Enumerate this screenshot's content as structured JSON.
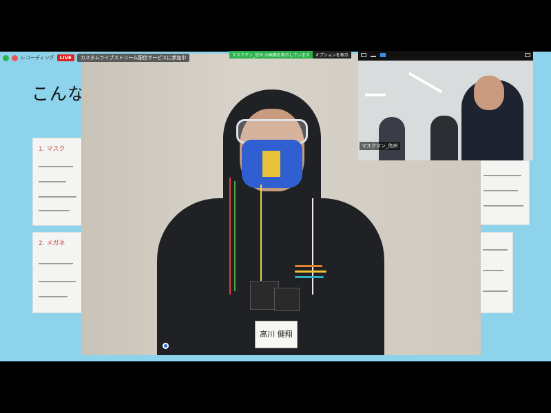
{
  "toolbar": {
    "recording_label": "レコーディング",
    "live_badge": "LIVE",
    "stream_status": "カスタムライブストリーム配信サービスに参加中",
    "sharing_status": "マスクマン_信州 の画面を表示しています",
    "options_button": "オプションを表示"
  },
  "slide": {
    "title": "こんな",
    "note1": "1. マスク",
    "note2": "2. メガネ",
    "name_tag": "高川 健翔"
  },
  "thumbnail": {
    "participant_name": "マスクマン_信州"
  },
  "colors": {
    "slide_bg": "#8ed3ec",
    "live": "#e02020",
    "sharing": "#2bb24c",
    "mask_device": "#2f5fd0"
  },
  "icons": [
    "recording-icon",
    "chevron-down-icon",
    "layout-icon",
    "minimize-icon",
    "expand-icon"
  ]
}
